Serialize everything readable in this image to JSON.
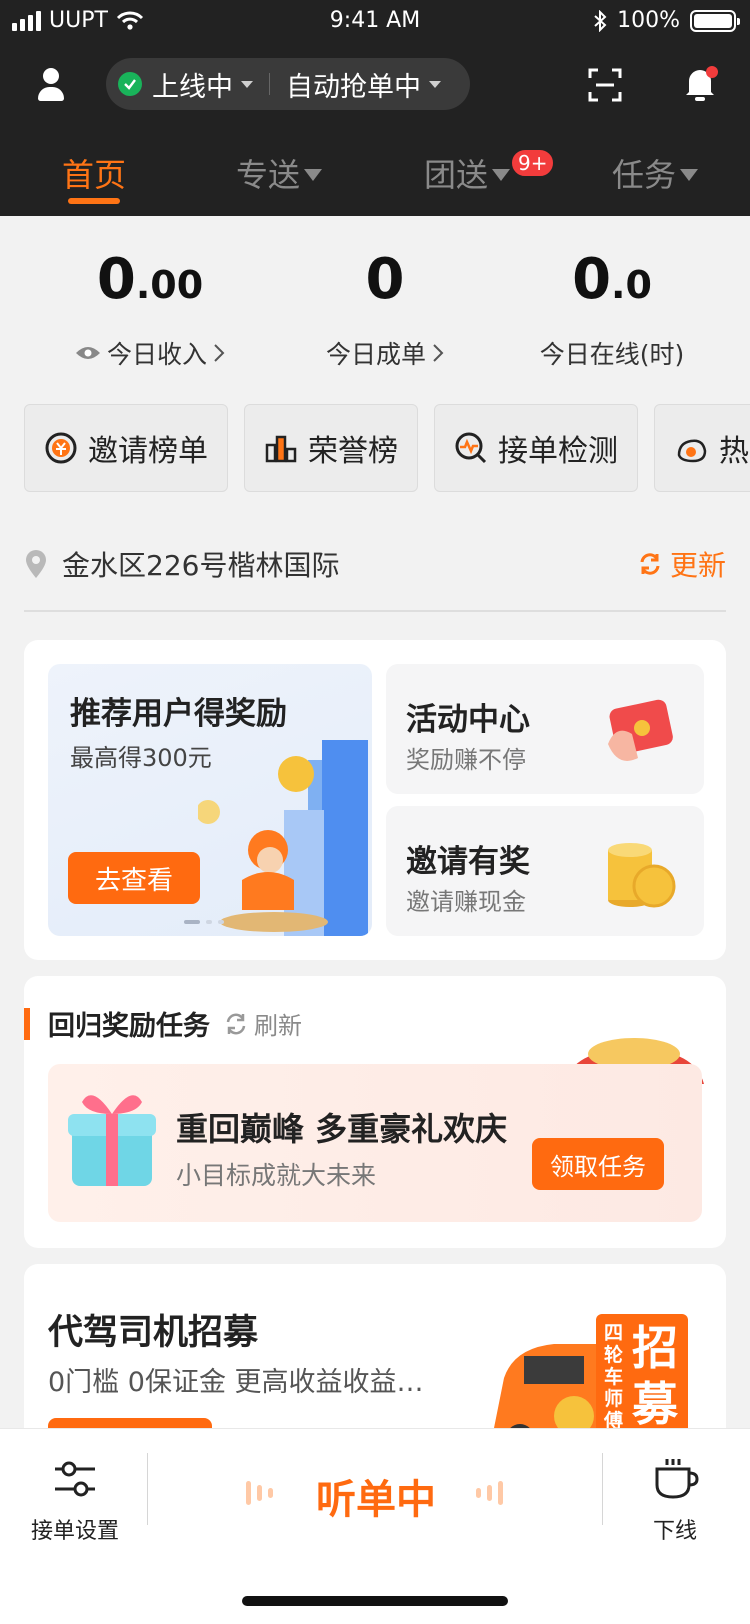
{
  "status_bar": {
    "carrier": "UUPT",
    "time": "9:41 AM",
    "battery": "100%"
  },
  "header": {
    "online_status": "上线中",
    "auto_grab": "自动抢单中"
  },
  "tabs": [
    {
      "label": "首页"
    },
    {
      "label": "专送"
    },
    {
      "label": "团送",
      "badge": "9+"
    },
    {
      "label": "任务"
    }
  ],
  "stats": [
    {
      "int": "0",
      "dec": ".00",
      "label": "今日收入"
    },
    {
      "int": "0",
      "dec": "",
      "label": "今日成单"
    },
    {
      "int": "0",
      "dec": ".0",
      "label": "今日在线(时)"
    }
  ],
  "quick_buttons": [
    {
      "label": "邀请榜单",
      "icon": "coin-yen-icon"
    },
    {
      "label": "荣誉榜",
      "icon": "bar-chart-icon"
    },
    {
      "label": "接单检测",
      "icon": "pulse-search-icon"
    },
    {
      "label": "热",
      "icon": "hot-icon"
    }
  ],
  "location": {
    "address": "金水区226号楷林国际",
    "update_label": "更新"
  },
  "promos": {
    "big": {
      "title": "推荐用户得奖励",
      "subtitle": "最高得300元",
      "cta": "去查看"
    },
    "activity": {
      "title": "活动中心",
      "subtitle": "奖励赚不停"
    },
    "invite": {
      "title": "邀请有奖",
      "subtitle": "邀请赚现金"
    }
  },
  "return_task": {
    "section_title": "回归奖励任务",
    "refresh_label": "刷新",
    "title": "重回巅峰 多重豪礼欢庆",
    "subtitle": "小目标成就大未来",
    "button": "领取任务"
  },
  "recruit": {
    "title": "代驾司机招募",
    "subtitle": "0门槛 0保证金  更高收益收益…",
    "banner_text": "招募",
    "banner_side": "四轮车师傅"
  },
  "bottom_bar": {
    "settings_label": "接单设置",
    "listening_label": "听单中",
    "offline_label": "下线"
  },
  "colors": {
    "accent": "#ff6a10",
    "header_bg": "#222222",
    "online_green": "#19b35a"
  }
}
